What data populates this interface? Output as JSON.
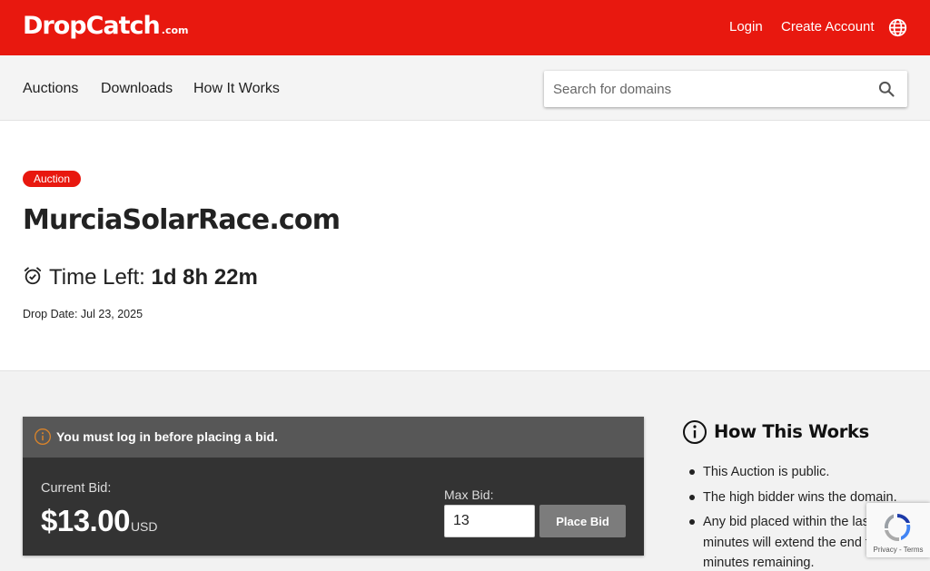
{
  "header": {
    "logo_text": "DropCatch",
    "logo_tld": ".com",
    "login_label": "Login",
    "create_account_label": "Create Account",
    "language_icon": "globe-icon"
  },
  "nav": {
    "items": [
      {
        "label": "Auctions"
      },
      {
        "label": "Downloads"
      },
      {
        "label": "How It Works"
      }
    ],
    "search_placeholder": "Search for domains",
    "search_icon": "search-icon"
  },
  "auction": {
    "badge": "Auction",
    "domain": "MurciaSolarRace.com",
    "time_left_label": "Time Left:",
    "time_left_value": "1d 8h 22m",
    "drop_date": "Drop Date: Jul 23, 2025"
  },
  "bid": {
    "warning": "You must log in before placing a bid.",
    "current_label": "Current Bid:",
    "current_value": "$13.00",
    "currency": "USD",
    "max_label": "Max Bid:",
    "max_value": "13",
    "place_bid_label": "Place Bid"
  },
  "how": {
    "title": "How This Works",
    "items": [
      "This Auction is public.",
      "The high bidder wins the domain.",
      "Any bid placed within the last 5 minutes will extend the end time to 5 minutes remaining."
    ]
  },
  "recaptcha": {
    "text": "Privacy - Terms"
  },
  "colors": {
    "brand_red": "#e8180f",
    "panel_dark": "#333333",
    "panel_header": "#575757",
    "warning_icon": "#d9832a"
  }
}
